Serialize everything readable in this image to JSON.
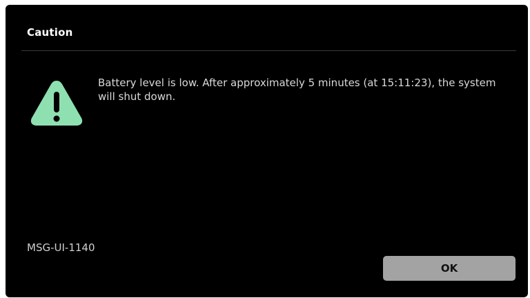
{
  "dialog": {
    "title": "Caution",
    "icon": "warning-triangle-icon",
    "icon_color": "#8ee0b0",
    "message": "Battery level is low. After approximately 5 minutes (at 15:11:23), the system will shut down.",
    "message_code": "MSG-UI-1140",
    "ok_label": "OK"
  },
  "colors": {
    "background": "#000000",
    "button": "#a3a3a3"
  }
}
